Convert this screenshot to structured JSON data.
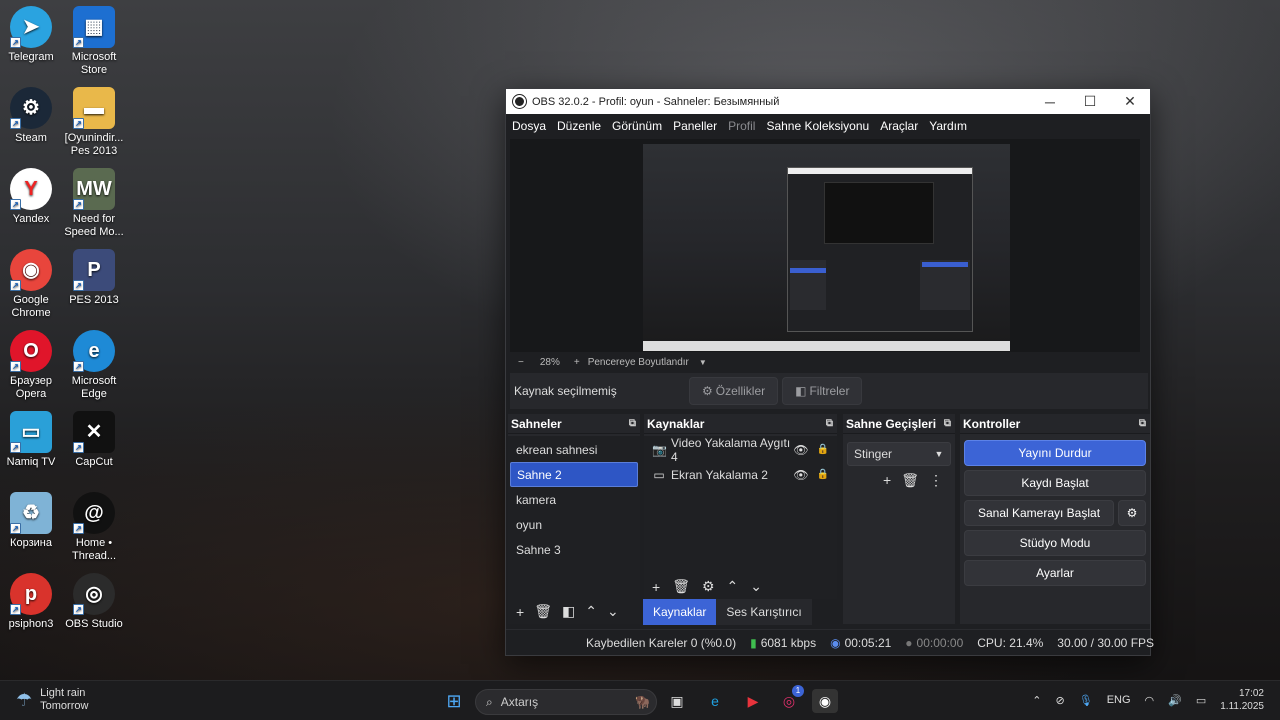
{
  "desktop": {
    "icons": [
      {
        "label": "Telegram",
        "glyph": "➤",
        "color": "#2aa3e0"
      },
      {
        "label": "Microsoft Store",
        "glyph": "▦",
        "color": "#1d6fd1"
      },
      {
        "label": "Steam",
        "glyph": "⚙",
        "color": "#1b2838"
      },
      {
        "label": "[Oyunindir... Pes 2013",
        "glyph": "▬",
        "color": "#e9b84a"
      },
      {
        "label": "Yandex",
        "glyph": "Y",
        "color": "#ffffff"
      },
      {
        "label": "Need for Speed Mo...",
        "glyph": "MW",
        "color": "#5a6a50"
      },
      {
        "label": "Google Chrome",
        "glyph": "◉",
        "color": "#e8453c"
      },
      {
        "label": "PES 2013",
        "glyph": "P",
        "color": "#3c4b7a"
      },
      {
        "label": "Браузер Opera",
        "glyph": "O",
        "color": "#e0152a"
      },
      {
        "label": "Microsoft Edge",
        "glyph": "e",
        "color": "#1e8ad6"
      },
      {
        "label": "Namiq TV",
        "glyph": "▭",
        "color": "#2aa0d8"
      },
      {
        "label": "CapCut",
        "glyph": "✕",
        "color": "#111111"
      },
      {
        "label": "Корзина",
        "glyph": "♻",
        "color": "#7fb3d6"
      },
      {
        "label": "Home • Thread...",
        "glyph": "@",
        "color": "#111111"
      },
      {
        "label": "psiphon3",
        "glyph": "p",
        "color": "#d9332c"
      },
      {
        "label": "OBS Studio",
        "glyph": "◎",
        "color": "#2b2b2b"
      }
    ]
  },
  "obs": {
    "title": "OBS 32.0.2 - Profil: oyun - Sahneler: Безымянный",
    "menu": [
      "Dosya",
      "Düzenle",
      "Görünüm",
      "Paneller",
      "Profil",
      "Sahne Koleksiyonu",
      "Araçlar",
      "Yardım"
    ],
    "zoom": {
      "minus": "−",
      "value": "28%",
      "plus": "+",
      "fit": "Pencereye Boyutlandır",
      "arrow": "▼"
    },
    "source_bar": {
      "label": "Kaynak seçilmemiş",
      "properties": "Özellikler",
      "filters": "Filtreler"
    },
    "scenes": {
      "header": "Sahneler",
      "items": [
        "ekrean sahnesi",
        "Sahne 2",
        "kamera",
        "oyun",
        "Sahne 3"
      ],
      "selected_index": 1
    },
    "sources": {
      "header": "Kaynaklar",
      "items": [
        {
          "label": "Video Yakalama Aygıtı 4",
          "icon": "camera-icon"
        },
        {
          "label": "Ekran Yakalama 2",
          "icon": "monitor-icon"
        }
      ]
    },
    "transitions": {
      "header": "Sahne Geçişleri",
      "selected": "Stinger"
    },
    "controls": {
      "header": "Kontroller",
      "stop_stream": "Yayını Durdur",
      "start_record": "Kaydı Başlat",
      "virtual_cam": "Sanal Kamerayı Başlat",
      "studio_mode": "Stüdyo Modu",
      "settings": "Ayarlar"
    },
    "dock_tabs": [
      "Kaynaklar",
      "Ses Karıştırıcı"
    ],
    "status": {
      "dropped": "Kaybedilen Kareler 0 (%0.0)",
      "bitrate": "6081 kbps",
      "stream_time": "00:05:21",
      "record_time": "00:00:00",
      "cpu": "CPU: 21.4%",
      "fps": "30.00 / 30.00 FPS"
    }
  },
  "taskbar": {
    "weather_line1": "Light rain",
    "weather_line2": "Tomorrow",
    "search_placeholder": "Axtarış",
    "lang": "ENG",
    "time": "17:02",
    "date": "1.11.2025",
    "instagram_badge": "1"
  }
}
